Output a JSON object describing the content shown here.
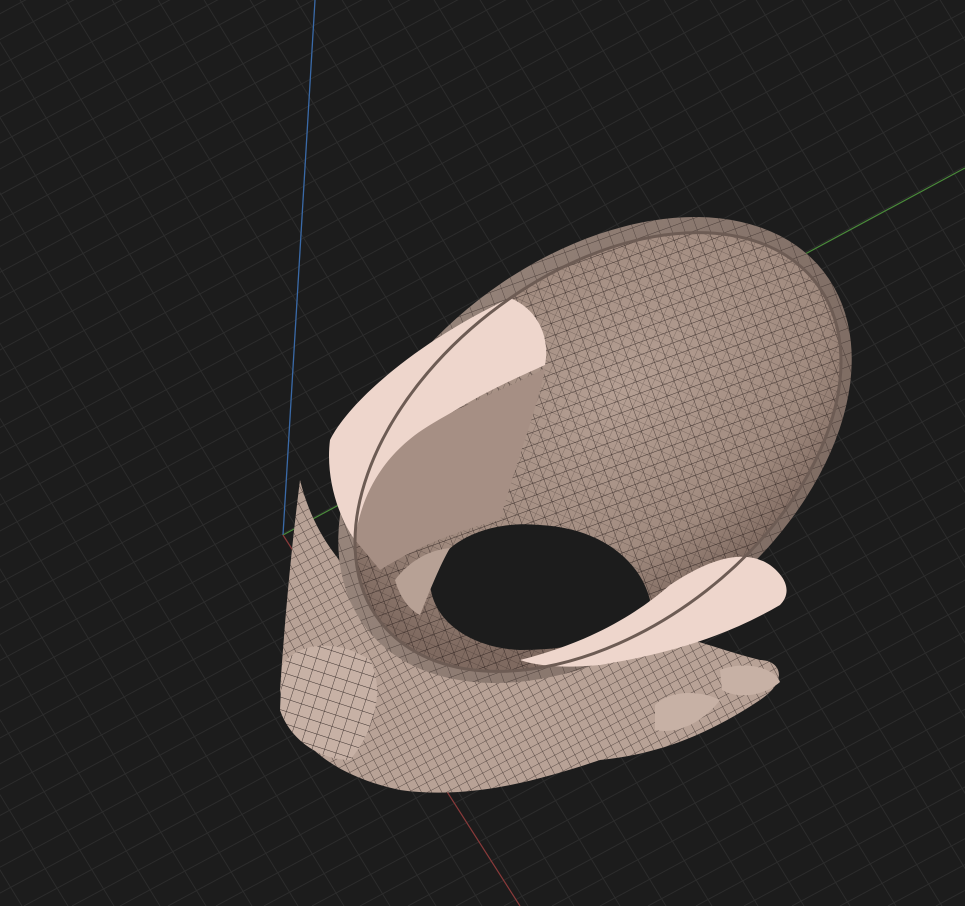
{
  "viewport": {
    "mode": "3d-perspective",
    "background_color": "#1c1c1c",
    "grid_color": "#2c2c2c",
    "axis_colors": {
      "x": "#8a3a3a",
      "y": "#4a8a3a",
      "z": "#3a6aa8"
    },
    "mesh_color": "#c4aea2",
    "cut_face_color": "#eed6cc",
    "wire_color": "#1a1110",
    "object": "face-mask-shell"
  }
}
